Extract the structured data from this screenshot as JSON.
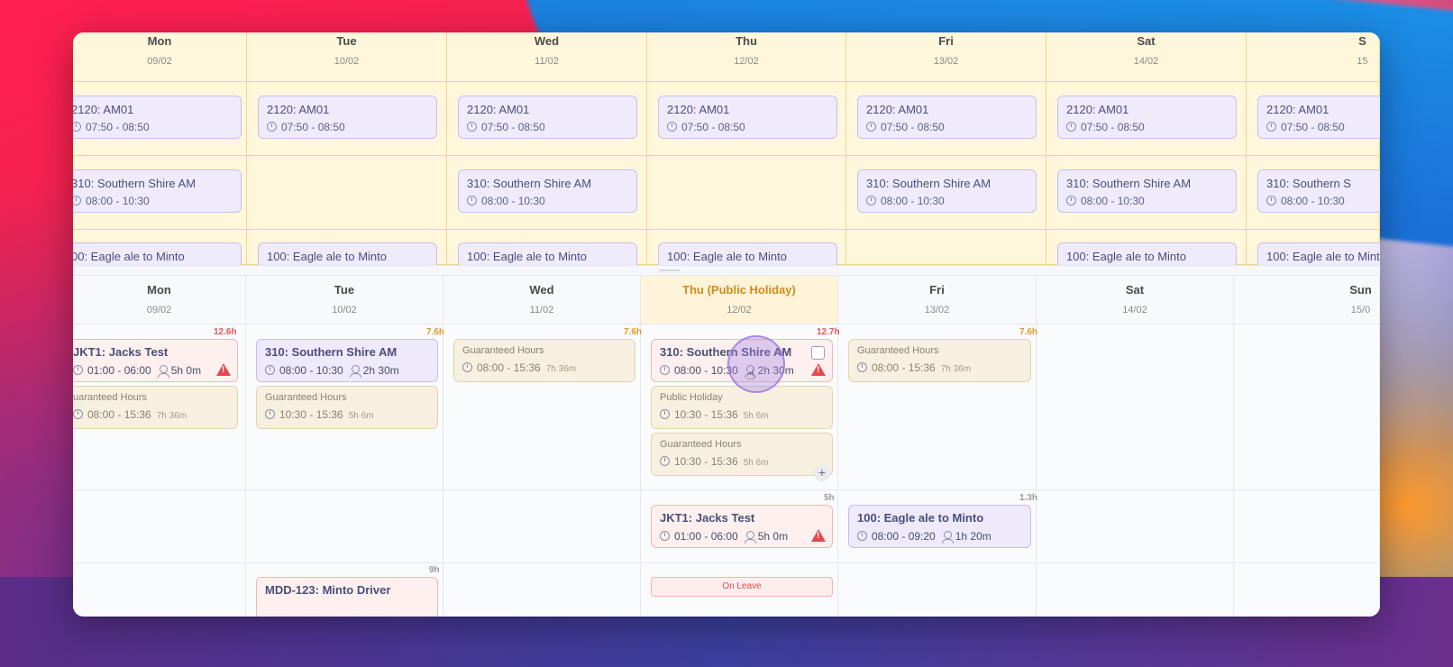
{
  "top_days": [
    {
      "name": "Mon",
      "date": "09/02"
    },
    {
      "name": "Tue",
      "date": "10/02"
    },
    {
      "name": "Wed",
      "date": "11/02"
    },
    {
      "name": "Thu",
      "date": "12/02"
    },
    {
      "name": "Fri",
      "date": "13/02"
    },
    {
      "name": "Sat",
      "date": "14/02"
    },
    {
      "name": "S",
      "date": "15"
    }
  ],
  "top_shifts": {
    "am01": {
      "title": "2120: AM01",
      "time": "07:50 - 08:50"
    },
    "am01_mon": {
      "title": "2120: AM01",
      "time": "07:50 - 08:50"
    },
    "southern": {
      "title": "310: Southern Shire AM",
      "time": "08:00 - 10:30"
    },
    "southern_mon": {
      "title": "310: Southern Shire AM",
      "time": "08:00 - 10:30"
    },
    "southern_sun": {
      "title": "310: Southern S",
      "time": "08:00 - 10:30"
    },
    "eagle": {
      "title": "100: Eagle ale to Minto"
    },
    "eagle_mon": {
      "title": "00: Eagle ale to Minto"
    }
  },
  "bottom_days": [
    {
      "name": "Mon",
      "date": "09/02"
    },
    {
      "name": "Tue",
      "date": "10/02"
    },
    {
      "name": "Wed",
      "date": "11/02"
    },
    {
      "name": "Thu (Public Holiday)",
      "date": "12/02"
    },
    {
      "name": "Fri",
      "date": "13/02"
    },
    {
      "name": "Sat",
      "date": "14/02"
    },
    {
      "name": "Sun",
      "date": "15/0"
    }
  ],
  "row1": {
    "mon": {
      "hours": "12.6h",
      "shift1": {
        "title": "JKT1: Jacks Test",
        "time": "01:00 - 06:00",
        "assigned": "5h 0m"
      },
      "shift2": {
        "title": "uaranteed Hours",
        "time": "08:00 - 15:36",
        "duration": "7h 36m"
      }
    },
    "tue": {
      "hours": "7.6h",
      "shift1": {
        "title": "310: Southern Shire AM",
        "time": "08:00 - 10:30",
        "assigned": "2h 30m"
      },
      "shift2": {
        "title": "Guaranteed Hours",
        "time": "10:30 - 15:36",
        "duration": "5h 6m"
      }
    },
    "wed": {
      "hours": "7.6h",
      "shift1": {
        "title": "Guaranteed Hours",
        "time": "08:00 - 15:36",
        "duration": "7h 36m"
      }
    },
    "thu": {
      "hours": "12.7h",
      "shift1": {
        "title": "310: Southern Shire AM",
        "time": "08:00 - 10:30",
        "assigned": "2h 30m"
      },
      "shift2": {
        "title": "Public Holiday",
        "time": "10:30 - 15:36",
        "duration": "5h 6m"
      },
      "shift3": {
        "title": "Guaranteed Hours",
        "time": "10:30 - 15:36",
        "duration": "5h 6m"
      },
      "add": "+"
    },
    "fri": {
      "hours": "7.6h",
      "shift1": {
        "title": "Guaranteed Hours",
        "time": "08:00 - 15:36",
        "duration": "7h 36m"
      }
    }
  },
  "row2": {
    "thu": {
      "hours": "5h",
      "shift1": {
        "title": "JKT1: Jacks Test",
        "time": "01:00 - 06:00",
        "assigned": "5h 0m"
      }
    },
    "fri": {
      "hours": "1.3h",
      "shift1": {
        "title": "100: Eagle ale to Minto",
        "time": "08:00 - 09:20",
        "assigned": "1h 20m"
      }
    }
  },
  "row3": {
    "tue": {
      "hours": "9h",
      "shift1": {
        "title": "MDD-123: Minto Driver"
      }
    },
    "thu": {
      "leave": "On Leave"
    }
  },
  "cursor": {
    "glyph": "☝"
  }
}
